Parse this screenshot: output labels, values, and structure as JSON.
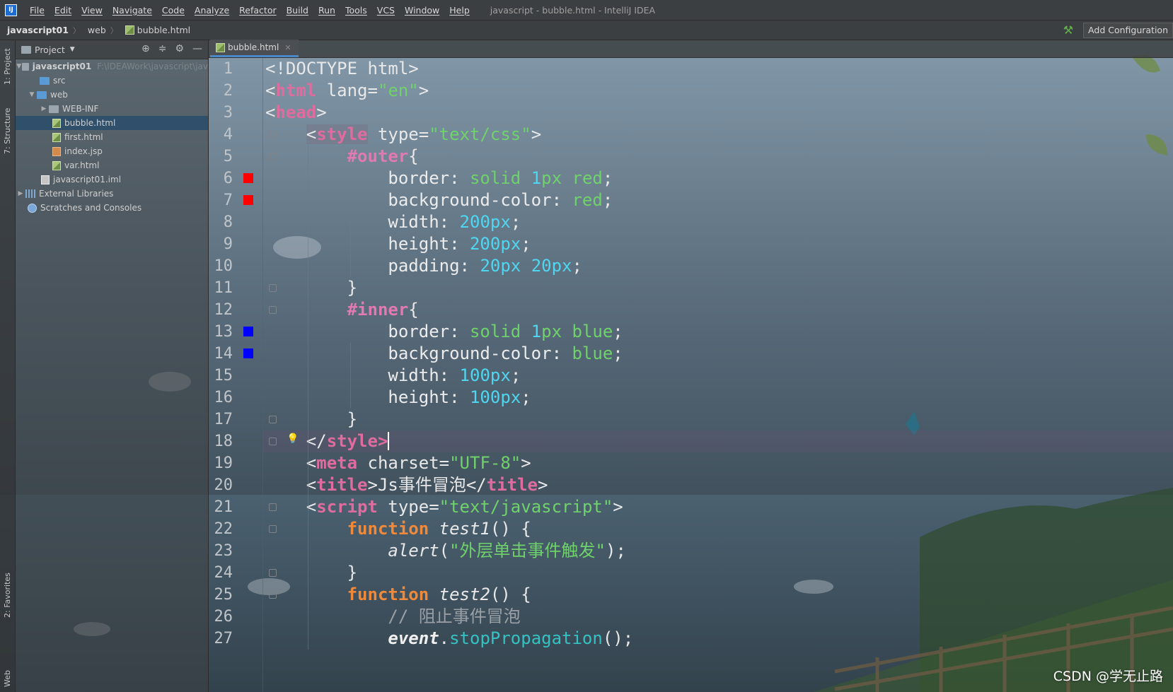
{
  "window": {
    "title": "javascript - bubble.html - IntelliJ IDEA",
    "app_icon": "IJ"
  },
  "menu": [
    "File",
    "Edit",
    "View",
    "Navigate",
    "Code",
    "Analyze",
    "Refactor",
    "Build",
    "Run",
    "Tools",
    "VCS",
    "Window",
    "Help"
  ],
  "breadcrumb": {
    "project": "javascript01",
    "folder": "web",
    "file": "bubble.html"
  },
  "toolbar": {
    "run_config_label": "Add Configuration"
  },
  "tool_windows": {
    "project_tab": "1: Project",
    "structure_tab": "7: Structure",
    "favorites_tab": "2: Favorites",
    "web_tab": "Web"
  },
  "project_panel": {
    "title": "Project",
    "tree": [
      {
        "label": "javascript01",
        "path": "F:\\IDEAWork\\javascript\\jav",
        "type": "project"
      },
      {
        "label": "src",
        "type": "folder-blue"
      },
      {
        "label": "web",
        "type": "folder-blue"
      },
      {
        "label": "WEB-INF",
        "type": "folder"
      },
      {
        "label": "bubble.html",
        "type": "html",
        "selected": true
      },
      {
        "label": "first.html",
        "type": "html"
      },
      {
        "label": "index.jsp",
        "type": "jsp"
      },
      {
        "label": "var.html",
        "type": "html"
      },
      {
        "label": "javascript01.iml",
        "type": "iml"
      },
      {
        "label": "External Libraries",
        "type": "lib"
      },
      {
        "label": "Scratches and Consoles",
        "type": "scratch"
      }
    ]
  },
  "editor": {
    "tab_label": "bubble.html",
    "current_line": 18,
    "swatches": {
      "6": "#ff0000",
      "7": "#ff0000",
      "13": "#0000ff",
      "14": "#0000ff"
    },
    "lines": [
      {
        "n": "1",
        "tokens": [
          [
            "",
            "<!DOCTYPE html>"
          ]
        ]
      },
      {
        "n": "2",
        "tokens": [
          [
            "",
            "<"
          ],
          [
            "t-tag",
            "html"
          ],
          [
            "t-attr",
            " lang="
          ],
          [
            "t-str",
            "\"en\""
          ],
          [
            "",
            ">"
          ]
        ]
      },
      {
        "n": "3",
        "tokens": [
          [
            "",
            "<"
          ],
          [
            "t-tag",
            "head"
          ],
          [
            "",
            ">"
          ]
        ]
      },
      {
        "n": "4",
        "tokens": [
          [
            "",
            "    "
          ],
          [
            "styletag-bg",
            "<"
          ],
          [
            "t-tag styletag-bg",
            "style"
          ],
          [
            "t-attr",
            " type="
          ],
          [
            "t-str",
            "\"text/css\""
          ],
          [
            "",
            ">"
          ]
        ]
      },
      {
        "n": "5",
        "tokens": [
          [
            "",
            "        "
          ],
          [
            "t-sel",
            "#outer"
          ],
          [
            "",
            "{"
          ]
        ]
      },
      {
        "n": "6",
        "tokens": [
          [
            "",
            "            "
          ],
          [
            "t-prop",
            "border: "
          ],
          [
            "t-val",
            "solid "
          ],
          [
            "t-num",
            "1"
          ],
          [
            "t-val",
            "px red"
          ],
          [
            "",
            ";"
          ]
        ]
      },
      {
        "n": "7",
        "tokens": [
          [
            "",
            "            "
          ],
          [
            "t-prop",
            "background-color: "
          ],
          [
            "t-val",
            "red"
          ],
          [
            "",
            ";"
          ]
        ]
      },
      {
        "n": "8",
        "tokens": [
          [
            "",
            "            "
          ],
          [
            "t-prop",
            "width: "
          ],
          [
            "t-num",
            "200"
          ],
          [
            "t-unit",
            "px"
          ],
          [
            "",
            ";"
          ]
        ]
      },
      {
        "n": "9",
        "tokens": [
          [
            "",
            "            "
          ],
          [
            "t-prop",
            "height: "
          ],
          [
            "t-num",
            "200"
          ],
          [
            "t-unit",
            "px"
          ],
          [
            "",
            ";"
          ]
        ]
      },
      {
        "n": "10",
        "tokens": [
          [
            "",
            "            "
          ],
          [
            "t-prop",
            "padding: "
          ],
          [
            "t-num",
            "20"
          ],
          [
            "t-unit",
            "px "
          ],
          [
            "t-num",
            "20"
          ],
          [
            "t-unit",
            "px"
          ],
          [
            "",
            ";"
          ]
        ]
      },
      {
        "n": "11",
        "tokens": [
          [
            "",
            "        }"
          ]
        ]
      },
      {
        "n": "12",
        "tokens": [
          [
            "",
            "        "
          ],
          [
            "t-sel",
            "#inner"
          ],
          [
            "",
            "{"
          ]
        ]
      },
      {
        "n": "13",
        "tokens": [
          [
            "",
            "            "
          ],
          [
            "t-prop",
            "border: "
          ],
          [
            "t-val",
            "solid "
          ],
          [
            "t-num",
            "1"
          ],
          [
            "t-val",
            "px blue"
          ],
          [
            "",
            ";"
          ]
        ]
      },
      {
        "n": "14",
        "tokens": [
          [
            "",
            "            "
          ],
          [
            "t-prop",
            "background-color: "
          ],
          [
            "t-val",
            "blue"
          ],
          [
            "",
            ";"
          ]
        ]
      },
      {
        "n": "15",
        "tokens": [
          [
            "",
            "            "
          ],
          [
            "t-prop",
            "width: "
          ],
          [
            "t-num",
            "100"
          ],
          [
            "t-unit",
            "px"
          ],
          [
            "",
            ";"
          ]
        ]
      },
      {
        "n": "16",
        "tokens": [
          [
            "",
            "            "
          ],
          [
            "t-prop",
            "height: "
          ],
          [
            "t-num",
            "100"
          ],
          [
            "t-unit",
            "px"
          ],
          [
            "",
            ";"
          ]
        ]
      },
      {
        "n": "17",
        "tokens": [
          [
            "",
            "        }"
          ]
        ]
      },
      {
        "n": "18",
        "tokens": [
          [
            "",
            "    </"
          ],
          [
            "t-tag",
            "style"
          ],
          [
            "t-tag",
            ">"
          ]
        ],
        "caret": true
      },
      {
        "n": "19",
        "tokens": [
          [
            "",
            "    <"
          ],
          [
            "t-tag",
            "meta"
          ],
          [
            "t-attr",
            " charset="
          ],
          [
            "t-str",
            "\"UTF-8\""
          ],
          [
            "",
            ">"
          ]
        ]
      },
      {
        "n": "20",
        "tokens": [
          [
            "",
            "    <"
          ],
          [
            "t-tag",
            "title"
          ],
          [
            "",
            ">Js事件冒泡</"
          ],
          [
            "t-tag",
            "title"
          ],
          [
            "",
            ">"
          ]
        ]
      },
      {
        "n": "21",
        "tokens": [
          [
            "",
            "    <"
          ],
          [
            "t-tag",
            "script"
          ],
          [
            "t-attr",
            " type="
          ],
          [
            "t-str",
            "\"text/javascript\""
          ],
          [
            "",
            ">"
          ]
        ]
      },
      {
        "n": "22",
        "tokens": [
          [
            "",
            "        "
          ],
          [
            "t-kw",
            "function "
          ],
          [
            "t-fn",
            "test1"
          ],
          [
            "",
            "() {"
          ]
        ]
      },
      {
        "n": "23",
        "tokens": [
          [
            "",
            "            "
          ],
          [
            "t-fn",
            "alert"
          ],
          [
            "",
            "("
          ],
          [
            "t-str",
            "\"外层单击事件触发\""
          ],
          [
            "",
            ");"
          ]
        ]
      },
      {
        "n": "24",
        "tokens": [
          [
            "",
            "        }"
          ]
        ]
      },
      {
        "n": "25",
        "tokens": [
          [
            "",
            "        "
          ],
          [
            "t-kw",
            "function "
          ],
          [
            "t-fn",
            "test2"
          ],
          [
            "",
            "() {"
          ]
        ]
      },
      {
        "n": "26",
        "tokens": [
          [
            "",
            "            "
          ],
          [
            "t-cm",
            "// 阻止事件冒泡"
          ]
        ]
      },
      {
        "n": "27",
        "tokens": [
          [
            "",
            "            "
          ],
          [
            "t-ev",
            "event"
          ],
          [
            "",
            "."
          ],
          [
            "t-call",
            "stopPropagation"
          ],
          [
            "",
            "();"
          ]
        ]
      }
    ]
  },
  "watermark": "CSDN @学无止路"
}
